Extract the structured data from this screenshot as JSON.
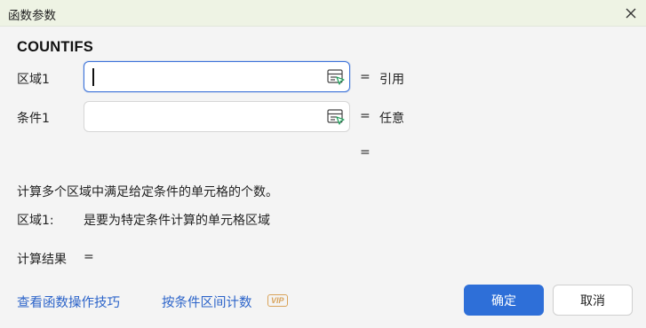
{
  "dialog": {
    "title": "函数参数",
    "function_name": "COUNTIFS"
  },
  "args": [
    {
      "label": "区域1",
      "value": "",
      "eq": "=",
      "type": "引用"
    },
    {
      "label": "条件1",
      "value": "",
      "eq": "=",
      "type": "任意"
    }
  ],
  "extra_eq": "=",
  "description": "计算多个区域中满足给定条件的单元格的个数。",
  "param_help": {
    "name": "区域1:",
    "text": "是要为特定条件计算的单元格区域"
  },
  "result": {
    "label": "计算结果",
    "eq": "="
  },
  "footer": {
    "link_tips": "查看函数操作技巧",
    "link_count": "按条件区间计数",
    "vip_badge": "VIP",
    "ok_label": "确定",
    "cancel_label": "取消"
  },
  "icons": {
    "close": "close-icon",
    "range_select": "range-select-icon"
  },
  "colors": {
    "titlebar_bg": "#eef3e4",
    "accent": "#2e6fd8",
    "link": "#2b63c9",
    "vip": "#d9a35a"
  }
}
